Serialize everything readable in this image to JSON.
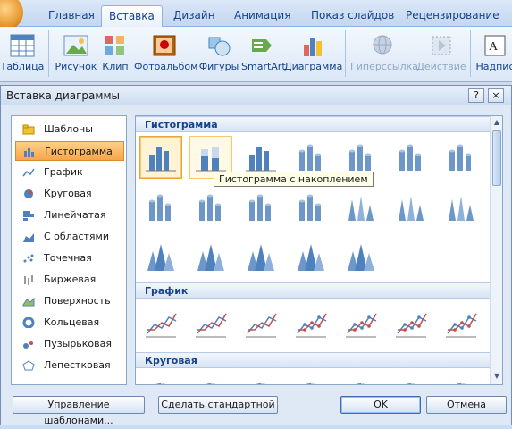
{
  "ribbon": {
    "tabs": [
      "Главная",
      "Вставка",
      "Дизайн",
      "Анимация",
      "Показ слайдов",
      "Рецензирование"
    ],
    "active_tab": "Вставка",
    "buttons": {
      "table": "Таблица",
      "picture": "Рисунок",
      "clip": "Клип",
      "album": "Фотоальбом",
      "shapes": "Фигуры",
      "smartart": "SmartArt",
      "chart": "Диаграмма",
      "hyperlink": "Гиперссылка",
      "action": "Действие",
      "textbox": "Надпис"
    }
  },
  "dialog": {
    "title": "Вставка диаграммы",
    "help": "?",
    "close": "×",
    "categories": [
      "Шаблоны",
      "Гистограмма",
      "График",
      "Круговая",
      "Линейчатая",
      "С областями",
      "Точечная",
      "Биржевая",
      "Поверхность",
      "Кольцевая",
      "Пузырьковая",
      "Лепестковая"
    ],
    "selected_category": "Гистограмма",
    "sections": {
      "histogram": "Гистограмма",
      "line": "График",
      "pie": "Круговая"
    },
    "tooltip": "Гистограмма с накоплением",
    "footer": {
      "manage_templates": "Управление шаблонами...",
      "set_default": "Сделать стандартной",
      "ok": "OK",
      "cancel": "Отмена"
    }
  },
  "colors": {
    "accent": "#4f81bd",
    "selection": "#f7a649",
    "ribbon_text": "#15428b"
  }
}
